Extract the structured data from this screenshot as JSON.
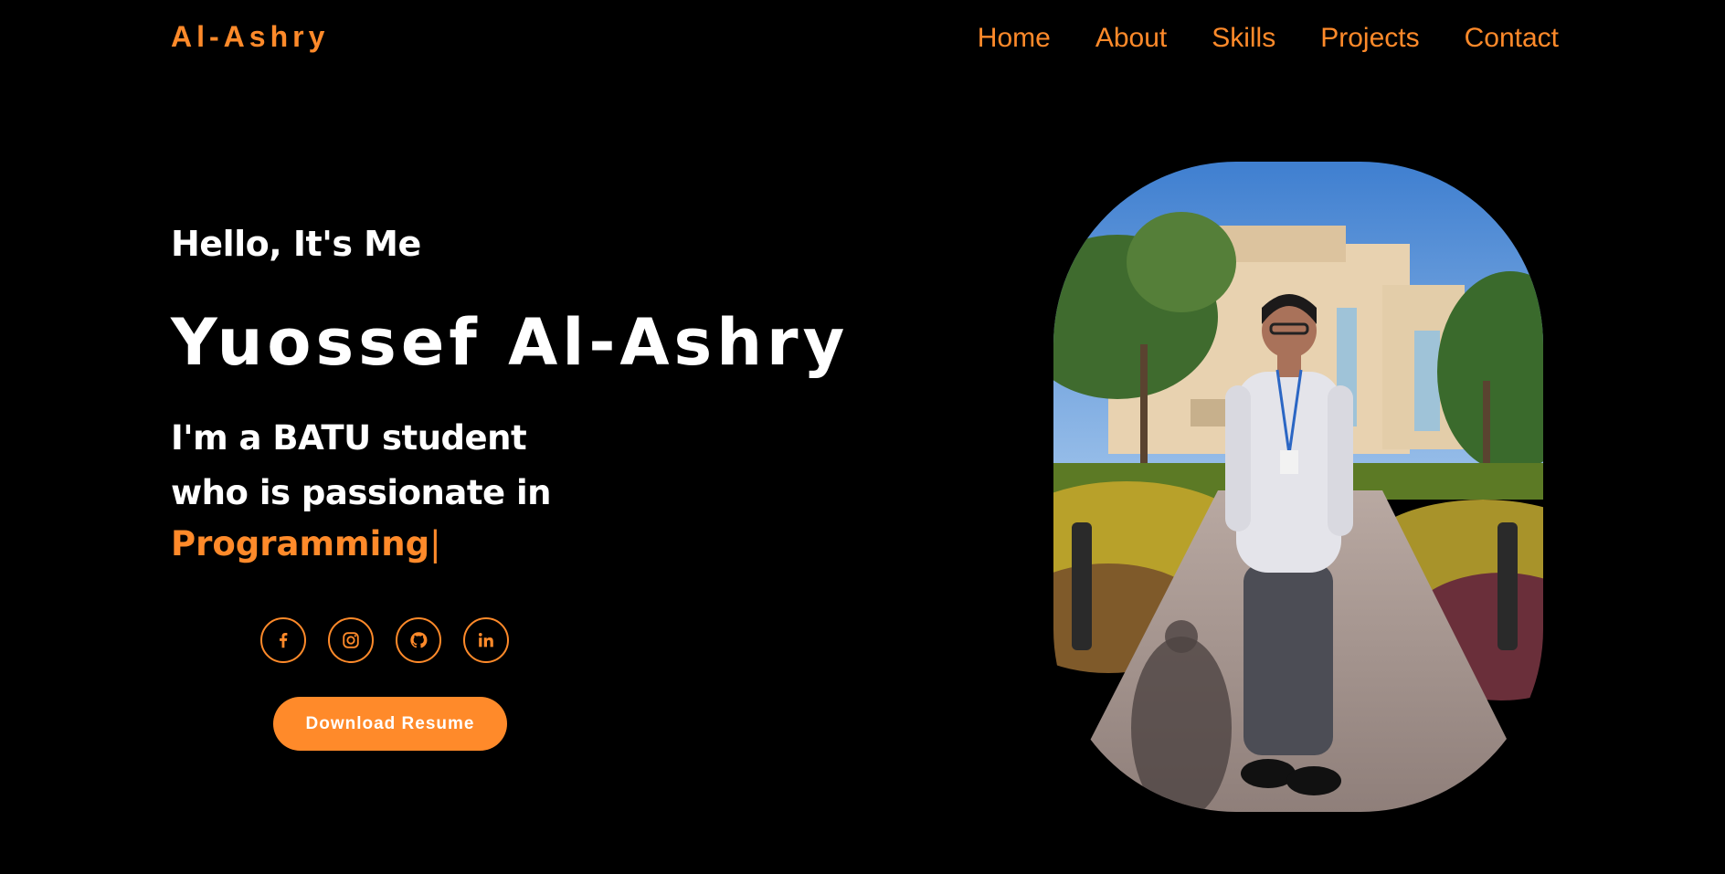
{
  "nav": {
    "logo": "Al-Ashry",
    "links": [
      "Home",
      "About",
      "Skills",
      "Projects",
      "Contact"
    ]
  },
  "hero": {
    "greeting": "Hello, It's Me",
    "name": "Yuossef Al-Ashry",
    "intro_line1": "I'm a BATU student",
    "intro_line2": "who is passionate in",
    "typed_word": "Programming",
    "cursor": "|",
    "resume_button": "Download Resume"
  },
  "socials": [
    {
      "name": "facebook-icon"
    },
    {
      "name": "instagram-icon"
    },
    {
      "name": "github-icon"
    },
    {
      "name": "linkedin-icon"
    }
  ],
  "colors": {
    "accent": "#ff8a2a",
    "background": "#000000",
    "text": "#ffffff"
  }
}
